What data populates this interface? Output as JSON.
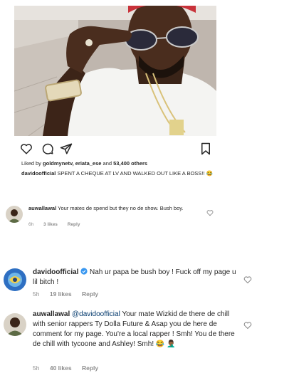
{
  "post": {
    "liked_by": "Liked by",
    "liked_users": "goldmynetv, eriata_ese",
    "and_word": "and",
    "others": "53,400 others",
    "caption_user": "davidoofficial",
    "caption_text": "SPENT A CHEQUE AT LV AND WALKED OUT LIKE A BOSS!! 😂"
  },
  "comments": [
    {
      "user": "auwallawal",
      "text": "Your mates de spend but they no de show. Bush boy.",
      "time": "6h",
      "likes": "3 likes",
      "reply": "Reply"
    },
    {
      "user": "davidoofficial",
      "verified": "✔",
      "text": "Nah ur papa be bush boy ! Fuck off my page u lil bitch !",
      "time": "5h",
      "likes": "19 likes",
      "reply": "Reply"
    },
    {
      "user": "auwallawal",
      "mention": "@davidoofficial",
      "text": "Your mate Wizkid de there de chill with senior rappers Ty Dolla Future & Asap you de here de comment for my page. You're a local rapper ! Smh! You de there de chill with tycoone and Ashley! Smh! 😂 🤦🏾‍♂️",
      "time": "5h",
      "likes": "40 likes",
      "reply": "Reply"
    }
  ],
  "colors": {
    "text": "#262626",
    "meta": "#8e8e8e",
    "verified": "#3897f0",
    "mention": "#00376b"
  },
  "icons": [
    "heart-icon",
    "comment-icon",
    "share-icon",
    "bookmark-icon",
    "verified-icon"
  ]
}
